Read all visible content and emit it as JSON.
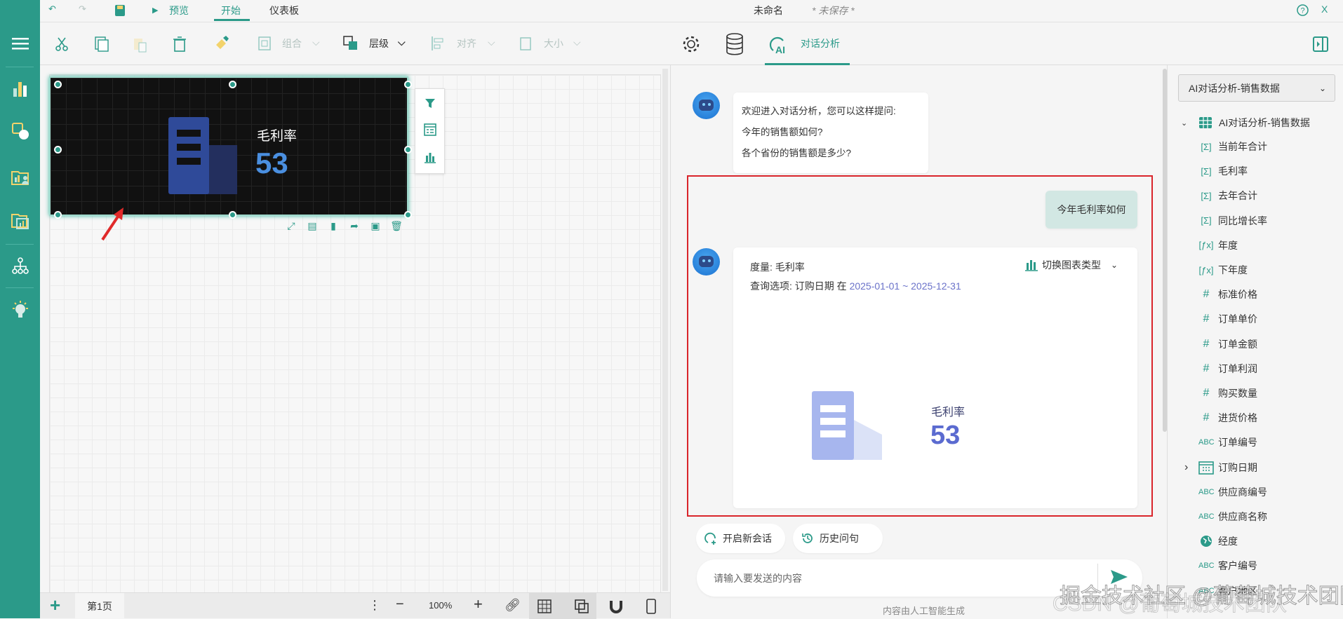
{
  "topbar": {
    "preview": "预览",
    "tab_start": "开始",
    "tab_dashboard": "仪表板",
    "doc_title": "未命名",
    "doc_status": "* 未保存 *"
  },
  "toolbar": {
    "group": "组合",
    "layer": "层级",
    "align": "对齐",
    "size": "大小",
    "chat_tab": "对话分析"
  },
  "widget": {
    "label": "毛利率",
    "value": "53"
  },
  "bottombar": {
    "page_tab": "第1页",
    "zoom": "100%"
  },
  "chat": {
    "welcome": [
      "欢迎进入对话分析，您可以这样提问:",
      "今年的销售额如何?",
      "各个省份的销售额是多少?"
    ],
    "user_question": "今年毛利率如何",
    "answer": {
      "measure_label": "度量:",
      "measure": "毛利率",
      "query_label": "查询选项:",
      "query_field": "订购日期 在",
      "query_range": "2025-01-01 ~ 2025-12-31",
      "switch_chart": "切换图表类型",
      "kpi_label": "毛利率",
      "kpi_value": "53"
    },
    "new_session": "开启新会话",
    "history": "历史问句",
    "input_placeholder": "请输入要发送的内容",
    "footnote": "内容由人工智能生成"
  },
  "fields": {
    "dataset_select": "AI对话分析-销售数据",
    "root": "AI对话分析-销售数据",
    "items": [
      {
        "icon": "[Σ]",
        "label": "当前年合计"
      },
      {
        "icon": "[Σ]",
        "label": "毛利率"
      },
      {
        "icon": "[Σ]",
        "label": "去年合计"
      },
      {
        "icon": "[Σ]",
        "label": "同比增长率"
      },
      {
        "icon": "[fx]",
        "label": "年度"
      },
      {
        "icon": "[fx]",
        "label": "下年度"
      },
      {
        "icon": "#",
        "label": "标准价格"
      },
      {
        "icon": "#",
        "label": "订单单价"
      },
      {
        "icon": "#",
        "label": "订单金额"
      },
      {
        "icon": "#",
        "label": "订单利润"
      },
      {
        "icon": "#",
        "label": "购买数量"
      },
      {
        "icon": "#",
        "label": "进货价格"
      },
      {
        "icon": "ABC",
        "label": "订单编号"
      },
      {
        "icon": "calendar",
        "label": "订购日期"
      },
      {
        "icon": "ABC",
        "label": "供应商编号"
      },
      {
        "icon": "ABC",
        "label": "供应商名称"
      },
      {
        "icon": "globe",
        "label": "经度"
      },
      {
        "icon": "ABC",
        "label": "客户编号"
      },
      {
        "icon": "ABC",
        "label": "客户地区"
      }
    ]
  },
  "watermark": [
    "掘金技术社区 @葡萄城技术团队",
    "CSDN @葡萄城技术团队"
  ],
  "colors": {
    "accent": "#2b9a89",
    "highlight": "#d9252b",
    "kpi_dark": "#4a8fe0",
    "kpi_light": "#5b6bd0"
  }
}
